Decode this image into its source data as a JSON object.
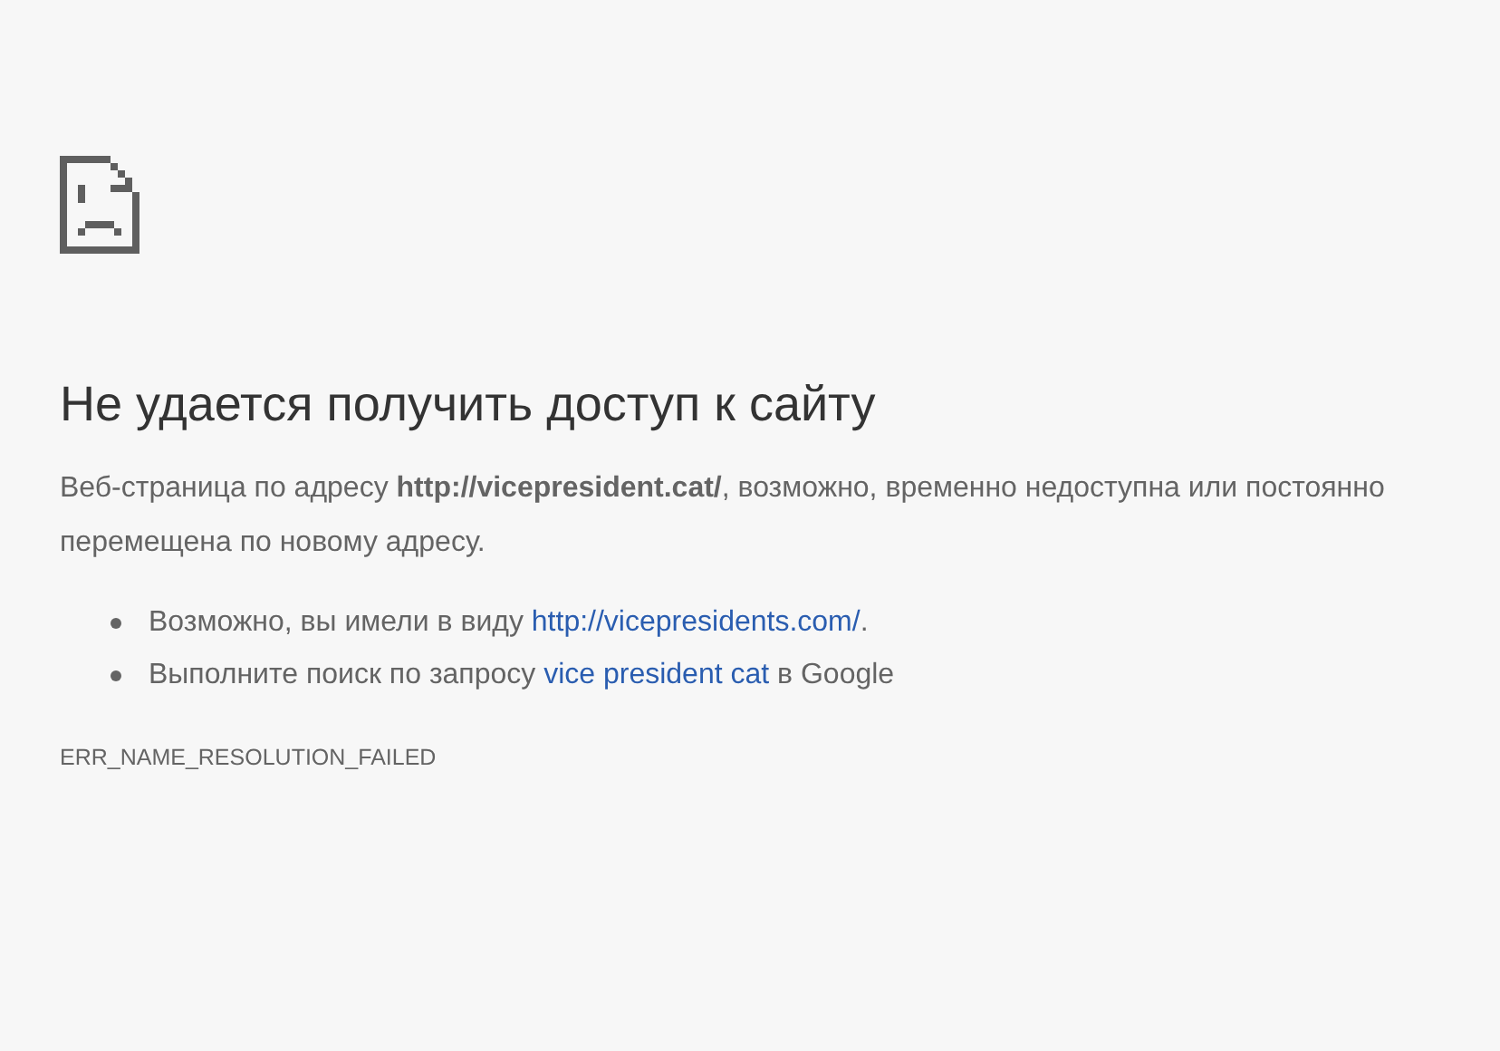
{
  "heading": "Не удается получить доступ к сайту",
  "message": "Веб-страница по адресу **http://vicepresident.cat/**, возможно, временно недоступна или постоянно перемещена по новому адресу.",
  "suggestions": [
    {
      "before": "Возможно, вы имели в виду ",
      "link": "http://vicepresidents.com/",
      "after": "."
    },
    {
      "before": "Выполните поиск по запросу ",
      "link": "vice president cat",
      "after": " в Google"
    }
  ],
  "error_code": "ERR_NAME_RESOLUTION_FAILED"
}
